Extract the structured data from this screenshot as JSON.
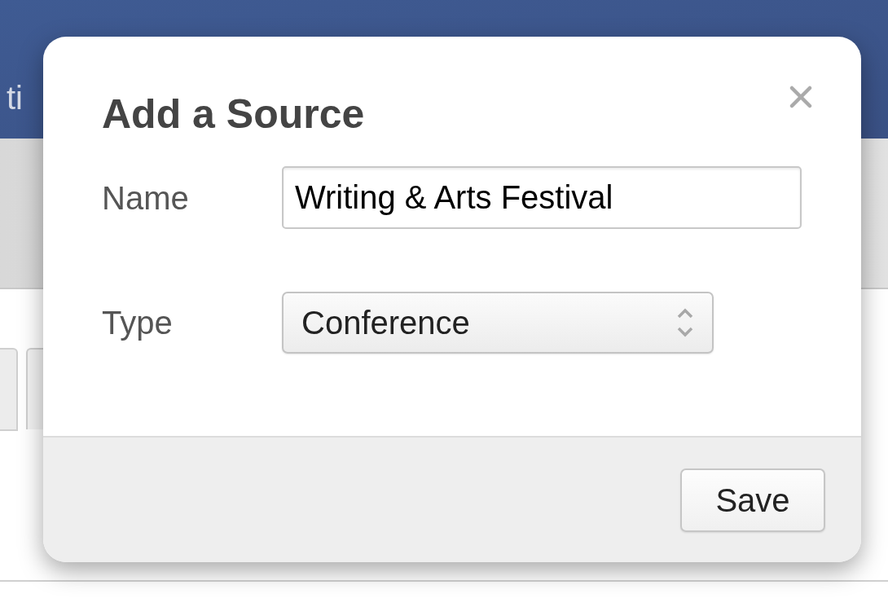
{
  "background": {
    "header_text": "ti"
  },
  "dialog": {
    "title": "Add a Source",
    "fields": [
      {
        "kind": "text",
        "label": "Name",
        "value": "Writing & Arts Festival"
      },
      {
        "kind": "select",
        "label": "Type",
        "value": "Conference"
      }
    ],
    "buttons": [
      "Save"
    ]
  }
}
